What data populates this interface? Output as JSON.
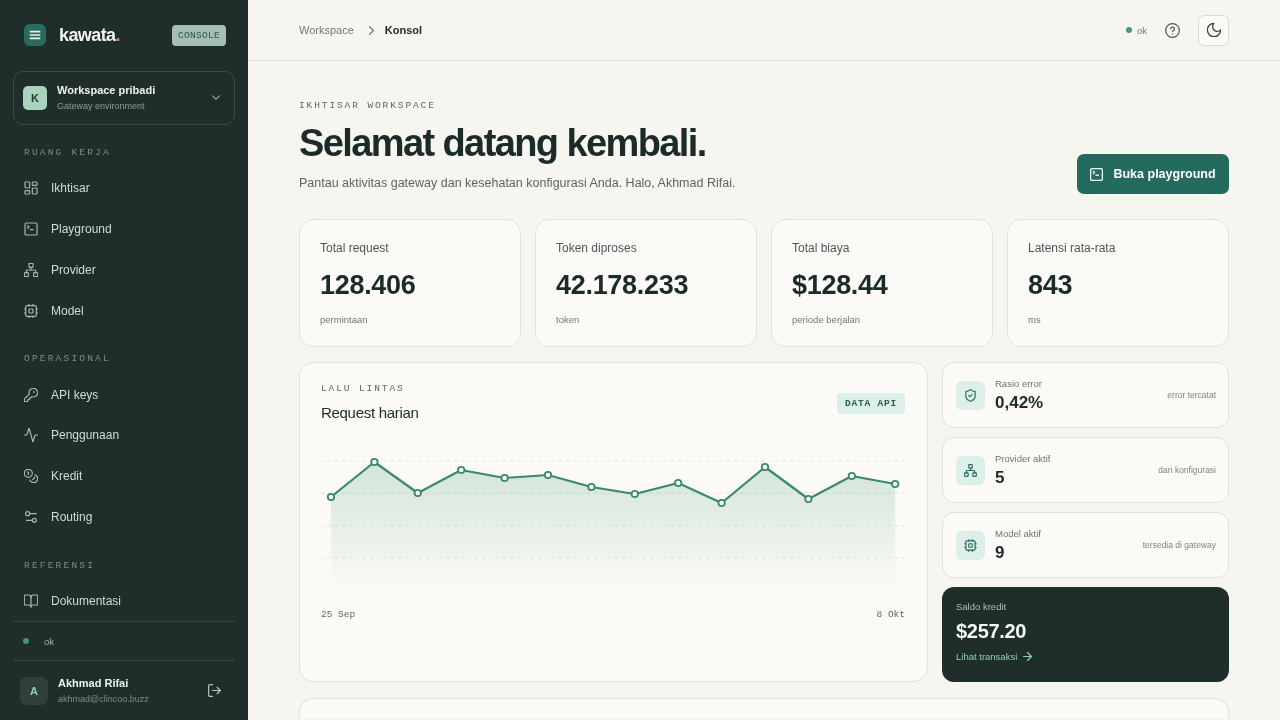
{
  "sidebar": {
    "brand": {
      "name": "kawata",
      "dot": "."
    },
    "badge": "CONSOLE",
    "workspace": {
      "initial": "K",
      "name": "Workspace pribadi",
      "subtitle": "Gateway environment"
    },
    "sections": [
      {
        "title": "RUANG KERJA",
        "items": [
          {
            "label": "Ikhtisar",
            "selected": false
          },
          {
            "label": "Playground",
            "selected": false
          },
          {
            "label": "Provider",
            "selected": false
          },
          {
            "label": "Model",
            "selected": false
          }
        ]
      },
      {
        "title": "OPERASIONAL",
        "items": [
          {
            "label": "API keys",
            "selected": false
          },
          {
            "label": "Penggunaan",
            "selected": false
          },
          {
            "label": "Kredit",
            "selected": false
          },
          {
            "label": "Routing",
            "selected": false
          }
        ]
      },
      {
        "title": "REFERENSI",
        "items": [
          {
            "label": "Dokumentasi",
            "selected": false
          }
        ]
      }
    ],
    "status": "ok",
    "user": {
      "initial": "A",
      "name": "Akhmad Rifai",
      "email": "akhmad@clincoo.buzz"
    }
  },
  "header": {
    "breadcrumbs": [
      "Workspace",
      "Konsol"
    ],
    "status": "ok"
  },
  "hero": {
    "eyebrow": "IKHTISAR WORKSPACE",
    "title": "Selamat datang kembali.",
    "subtitle": "Pantau aktivitas gateway dan kesehatan konfigurasi Anda. Halo, Akhmad Rifai.",
    "button": "Buka playground"
  },
  "stats": [
    {
      "label": "Total request",
      "value": "128.406",
      "unit": "permintaan"
    },
    {
      "label": "Token diproses",
      "value": "42.178.233",
      "unit": "token"
    },
    {
      "label": "Total biaya",
      "value": "$128.44",
      "unit": "periode berjalan"
    },
    {
      "label": "Latensi rata-rata",
      "value": "843",
      "unit": "ms"
    }
  ],
  "traffic": {
    "eyebrow": "LALU LINTAS",
    "title": "Request harian",
    "badge": "DATA API",
    "x_start": "25 Sep",
    "x_end": "8 Okt"
  },
  "side_stats": [
    {
      "label": "Rasio error",
      "value": "0,42%",
      "note": "error tercatat"
    },
    {
      "label": "Provider aktif",
      "value": "5",
      "note": "dari konfigurasi"
    },
    {
      "label": "Model aktif",
      "value": "9",
      "note": "tersedia di gateway"
    }
  ],
  "credit": {
    "label": "Saldo kredit",
    "value": "$257.20",
    "link": "Lihat transaksi"
  }
}
